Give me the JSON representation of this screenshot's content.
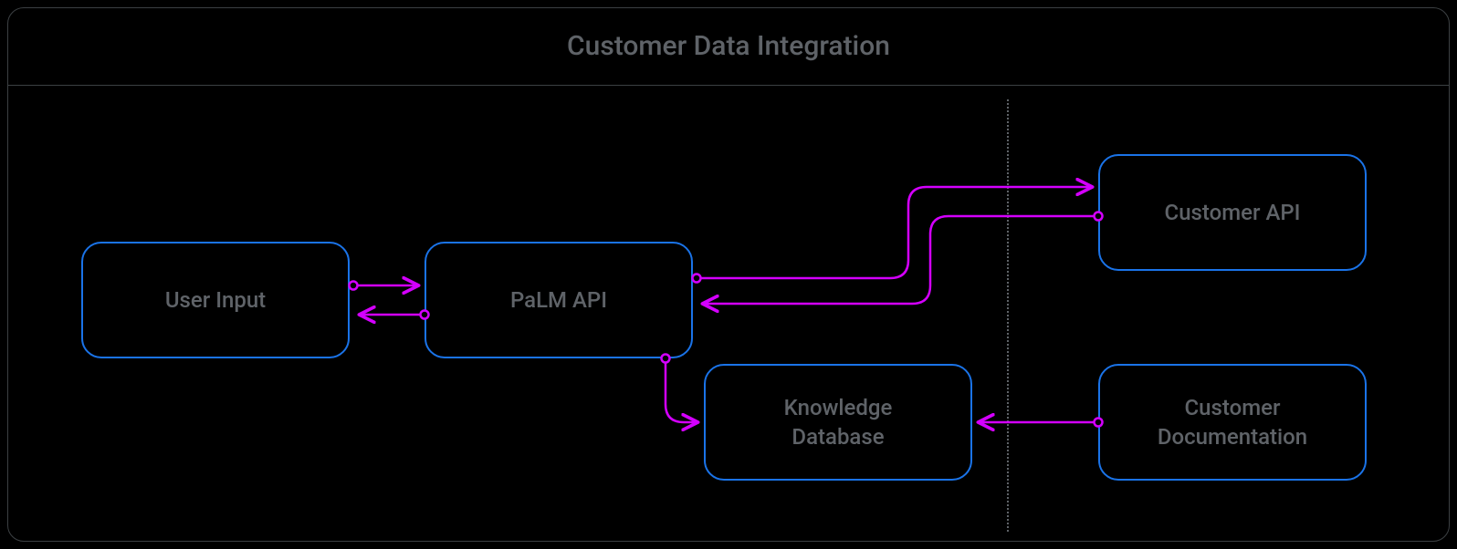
{
  "title": "Customer Data Integration",
  "nodes": {
    "user_input": {
      "label": "User Input"
    },
    "palm_api": {
      "label": "PaLM API"
    },
    "knowledge_db": {
      "label": "Knowledge\nDatabase"
    },
    "customer_api": {
      "label": "Customer API"
    },
    "customer_doc": {
      "label": "Customer\nDocumentation"
    }
  },
  "colors": {
    "node_border": "#1a73e8",
    "connector": "#d400ff",
    "text": "#5f6368",
    "frame": "#3c4043"
  },
  "connectors": [
    {
      "from": "user_input",
      "to": "palm_api",
      "bidirectional": true
    },
    {
      "from": "palm_api",
      "to": "customer_api",
      "bidirectional": true
    },
    {
      "from": "palm_api",
      "to": "knowledge_db",
      "bidirectional": false
    },
    {
      "from": "customer_doc",
      "to": "knowledge_db",
      "bidirectional": false
    }
  ]
}
